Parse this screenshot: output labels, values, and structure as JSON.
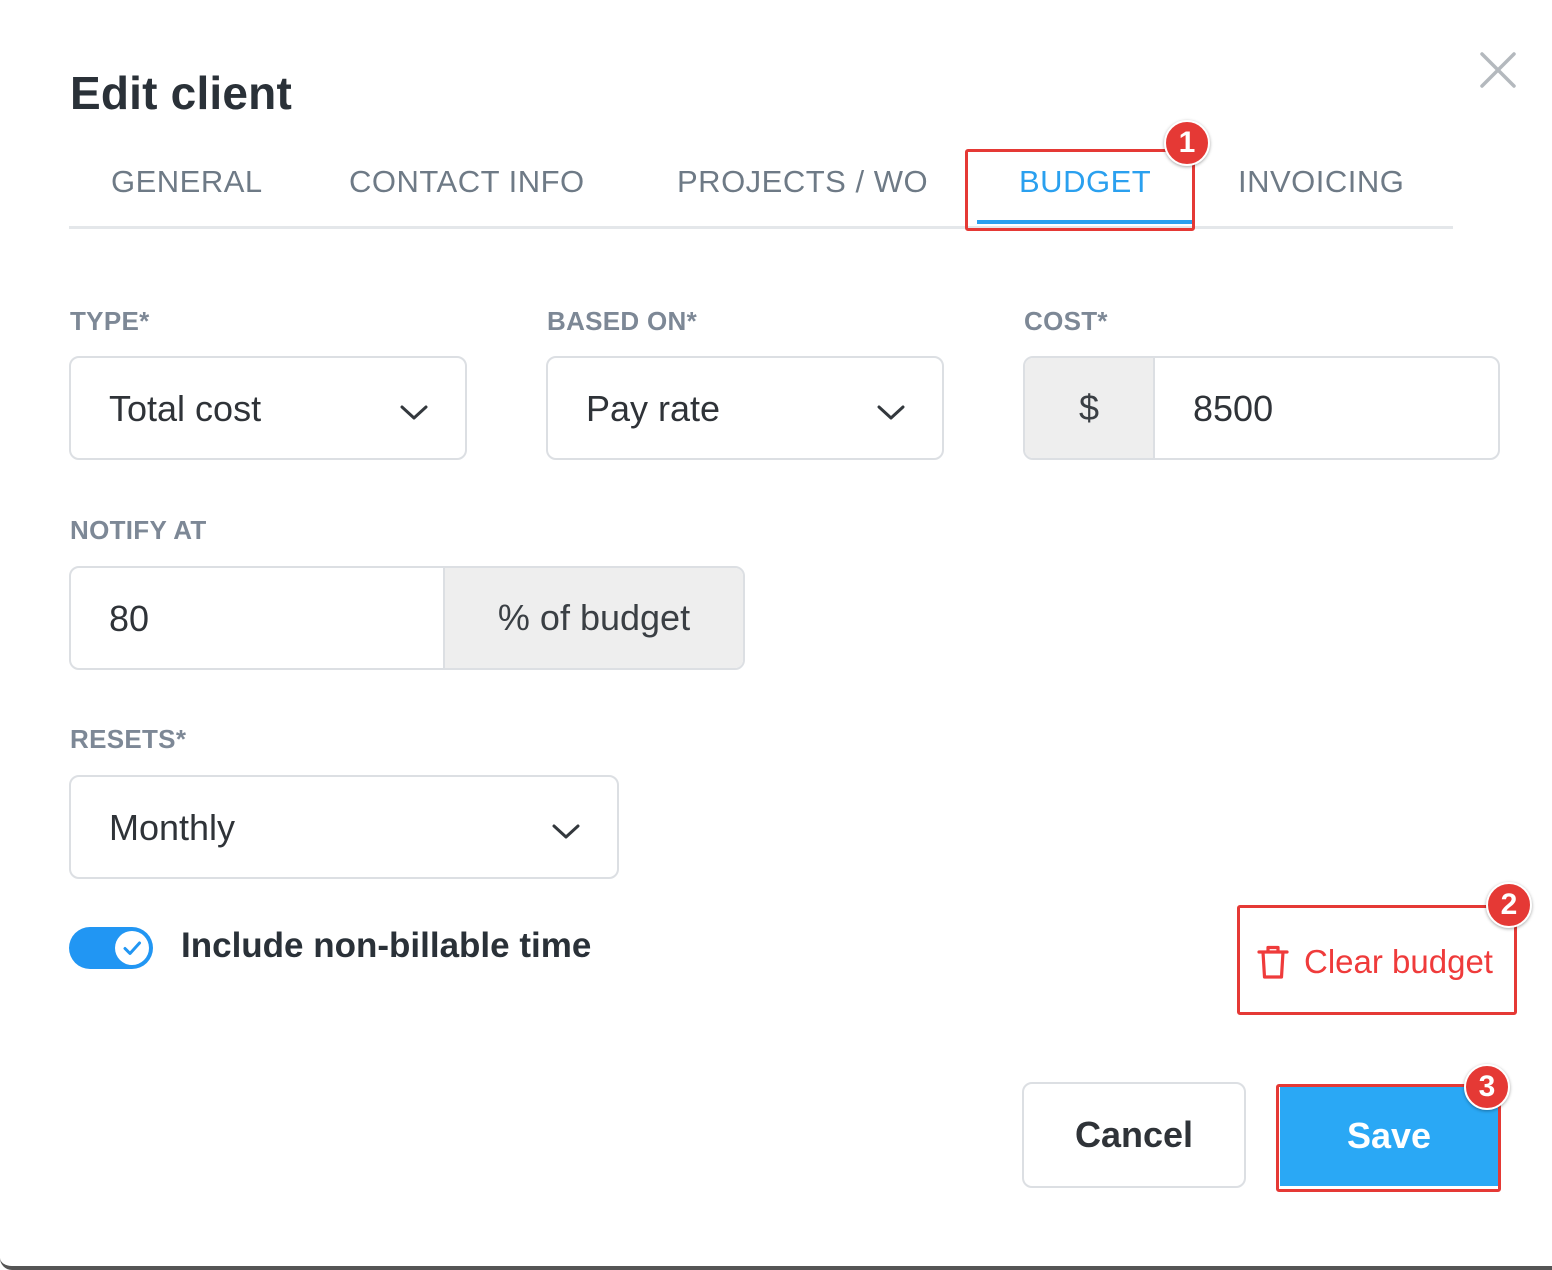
{
  "dialog": {
    "title": "Edit client",
    "close_icon": "close-icon"
  },
  "tabs": [
    {
      "label": "GENERAL",
      "active": false
    },
    {
      "label": "CONTACT INFO",
      "active": false
    },
    {
      "label": "PROJECTS / WO",
      "active": false
    },
    {
      "label": "BUDGET",
      "active": true
    },
    {
      "label": "INVOICING",
      "active": false
    }
  ],
  "form": {
    "type": {
      "label": "TYPE*",
      "value": "Total cost"
    },
    "based_on": {
      "label": "BASED ON*",
      "value": "Pay rate"
    },
    "cost": {
      "label": "COST*",
      "prefix": "$",
      "value": "8500"
    },
    "notify_at": {
      "label": "NOTIFY AT",
      "value": "80",
      "suffix": "% of budget"
    },
    "resets": {
      "label": "RESETS*",
      "value": "Monthly"
    },
    "include_non_billable": {
      "label": "Include non-billable time",
      "checked": true
    }
  },
  "actions": {
    "clear_budget": "Clear budget",
    "cancel": "Cancel",
    "save": "Save"
  },
  "annotations": {
    "badge_1": "1",
    "badge_2": "2",
    "badge_3": "3"
  },
  "colors": {
    "accent": "#2aa0ef",
    "danger": "#ef3b3b",
    "highlight": "#e53935"
  }
}
